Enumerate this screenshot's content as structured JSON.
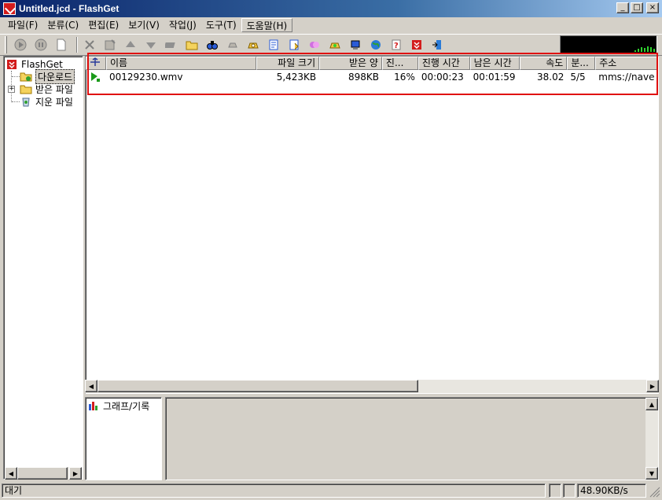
{
  "window": {
    "title": "Untitled.jcd - FlashGet"
  },
  "window_buttons": {
    "minimize": "_",
    "maximize": "□",
    "close": "×"
  },
  "menu": {
    "items": [
      {
        "label": "파일(F)"
      },
      {
        "label": "분류(C)"
      },
      {
        "label": "편집(E)"
      },
      {
        "label": "보기(V)"
      },
      {
        "label": "작업(J)"
      },
      {
        "label": "도구(T)"
      },
      {
        "label": "도움말(H)"
      }
    ]
  },
  "toolbar": {
    "icons": [
      "play-icon",
      "stop-icon",
      "new-file-icon",
      "delete-icon",
      "properties-icon",
      "move-up-icon",
      "move-down-icon",
      "schedule-icon",
      "open-folder-icon",
      "search-icon",
      "hangup-icon",
      "dialup-icon",
      "site-manager-icon",
      "category-icon",
      "skin-icon",
      "connect-icon",
      "clipboard-icon",
      "globe-icon",
      "help-icon",
      "flashget-icon",
      "exit-icon"
    ]
  },
  "tree": {
    "root": "FlashGet",
    "items": [
      {
        "label": "다운로드",
        "icon": "downloading-icon"
      },
      {
        "label": "받은 파일",
        "icon": "folder-icon"
      },
      {
        "label": "지운 파일",
        "icon": "recycle-icon"
      }
    ]
  },
  "list": {
    "columns": [
      "이름",
      "파일 크기",
      "받은 양",
      "진...",
      "진행 시간",
      "남은 시간",
      "속도",
      "분...",
      "주소"
    ],
    "rows": [
      {
        "name": "00129230.wmv",
        "size": "5,423KB",
        "received": "898KB",
        "progress": "16%",
        "elapsed": "00:00:23",
        "remaining": "00:01:59",
        "speed": "38.02",
        "segments": "5/5",
        "url": "mms://nave"
      }
    ]
  },
  "bottom": {
    "tab_label": "그래프/기록"
  },
  "status": {
    "text": "대기",
    "speed": "48.90KB/s"
  },
  "colors": {
    "highlight": "#e01010",
    "title_start": "#0a246a",
    "title_end": "#a6caf0",
    "monitor_graph": "#2fd32f"
  }
}
